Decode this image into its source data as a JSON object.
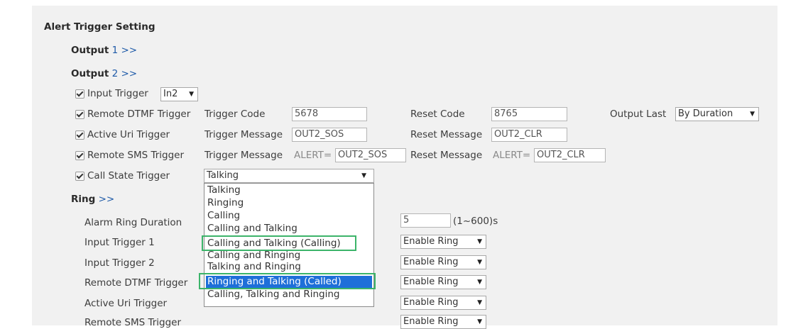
{
  "section_title": "Alert Trigger Setting",
  "output1": {
    "label": "Output",
    "num": "1 >>"
  },
  "output2": {
    "label": "Output",
    "num": "2 >>"
  },
  "input_trigger": {
    "label": "Input Trigger",
    "value": "In2"
  },
  "remote_dtmf": {
    "label": "Remote DTMF Trigger",
    "trigger_code_label": "Trigger Code",
    "trigger_code": "5678",
    "reset_code_label": "Reset Code",
    "reset_code": "8765",
    "output_last_label": "Output Last",
    "output_last": "By Duration"
  },
  "active_uri": {
    "label": "Active Uri Trigger",
    "trigger_msg_label": "Trigger Message",
    "trigger_msg": "OUT2_SOS",
    "reset_msg_label": "Reset Message",
    "reset_msg": "OUT2_CLR"
  },
  "remote_sms": {
    "label": "Remote SMS Trigger",
    "trigger_msg_label": "Trigger Message",
    "prefix": "ALERT=",
    "trigger_msg": "OUT2_SOS",
    "reset_msg_label": "Reset Message",
    "reset_msg": "OUT2_CLR"
  },
  "call_state": {
    "label": "Call State Trigger",
    "selected": "Talking",
    "options": [
      "Talking",
      "Ringing",
      "Calling",
      "Calling and Talking",
      "Calling and Talking (Calling)",
      "Calling and Ringing",
      "Talking and Ringing",
      "Ringing and Talking (Called)",
      "Calling, Talking and Ringing"
    ],
    "highlighted_index": 7,
    "selection_color": "#1e6fd9",
    "outline_color": "#3cb46a"
  },
  "ring": {
    "label": "Ring",
    "arrows": ">>",
    "alarm_duration_label": "Alarm Ring Duration",
    "alarm_duration": "5",
    "alarm_range": "(1~600)s",
    "rows": [
      {
        "label": "Input Trigger 1",
        "value": "Enable Ring"
      },
      {
        "label": "Input Trigger 2",
        "value": "Enable Ring"
      },
      {
        "label": "Remote DTMF Trigger",
        "value": "Enable Ring"
      },
      {
        "label": "Active Uri Trigger",
        "value": "Enable Ring"
      },
      {
        "label": "Remote SMS Trigger",
        "value": "Enable Ring"
      }
    ]
  },
  "dropdown_arrow": "▼"
}
